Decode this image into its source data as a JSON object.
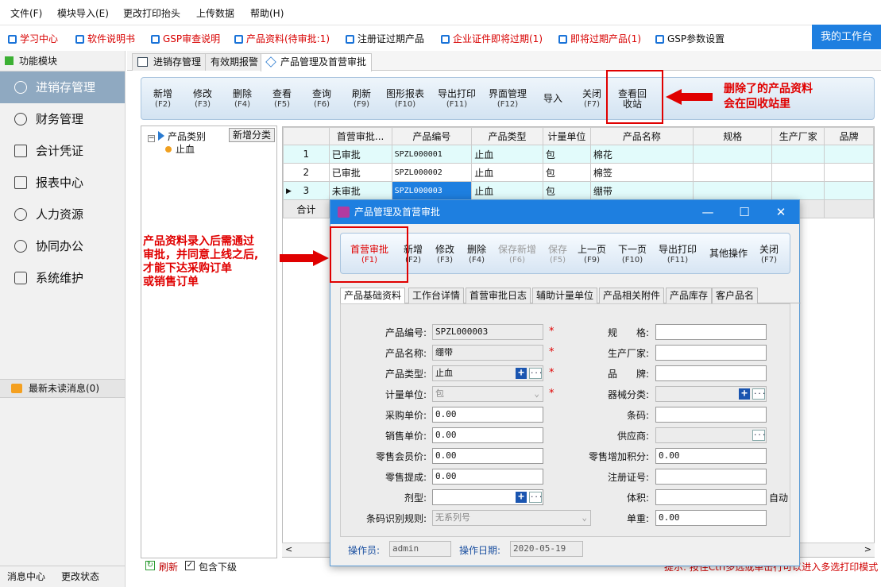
{
  "menubar": {
    "file": "文件(F)",
    "import": "模块导入(E)",
    "print_header": "更改打印抬头",
    "upload": "上传数据",
    "help": "帮助(H)"
  },
  "quickbar": {
    "items": [
      "学习中心",
      "软件说明书",
      "GSP审查说明",
      "产品资料(待审批:1)",
      "注册证过期产品",
      "企业证件即将过期(1)",
      "即将过期产品(1)",
      "GSP参数设置"
    ],
    "workbench": "我的工作台"
  },
  "leftnav": {
    "header": "功能模块",
    "items": [
      "进销存管理",
      "财务管理",
      "会计凭证",
      "报表中心",
      "人力资源",
      "协同办公",
      "系统维护"
    ],
    "messages": "最新未读消息(0)",
    "footer": [
      "消息中心",
      "更改状态"
    ]
  },
  "tabs": [
    "进销存管理",
    "有效期报警",
    "产品管理及首营审批"
  ],
  "toolbar": [
    {
      "label": "新增",
      "key": "(F2)"
    },
    {
      "label": "修改",
      "key": "(F3)"
    },
    {
      "label": "删除",
      "key": "(F4)"
    },
    {
      "label": "查看",
      "key": "(F5)"
    },
    {
      "label": "查询",
      "key": "(F6)"
    },
    {
      "label": "刷新",
      "key": "(F9)"
    },
    {
      "label": "图形报表",
      "key": "(F10)"
    },
    {
      "label": "导出打印",
      "key": "(F11)"
    },
    {
      "label": "界面管理",
      "key": "(F12)"
    },
    {
      "label": "导入",
      "key": ""
    },
    {
      "label": "关闭",
      "key": "(F7)"
    },
    {
      "label": "查看回",
      "key": "收站"
    }
  ],
  "tree": {
    "root": "产品类别",
    "add_button": "新增分类",
    "child": "止血"
  },
  "grid": {
    "columns": [
      "首营审批...",
      "产品编号",
      "产品类型",
      "计量单位",
      "产品名称",
      "规格",
      "生产厂家",
      "品牌"
    ],
    "rows": [
      [
        "1",
        "已审批",
        "SPZL000001",
        "止血",
        "包",
        "棉花",
        "",
        "",
        ""
      ],
      [
        "2",
        "已审批",
        "SPZL000002",
        "止血",
        "包",
        "棉签",
        "",
        "",
        ""
      ],
      [
        "3",
        "未审批",
        "SPZL000003",
        "止血",
        "包",
        "绷带",
        "",
        "",
        ""
      ]
    ],
    "total_label": "合计"
  },
  "bottombar": {
    "refresh": "刷新",
    "include_sub": "包含下级",
    "hint": "提示: 按住Ctrl多选或单击行可以进入多选打印模式"
  },
  "annotations": {
    "recycle": [
      "删除了的产品资料",
      "会在回收站里"
    ],
    "approval": [
      "产品资料录入后需通过",
      "审批，并同意上线之后,",
      "才能下达采购订单",
      "或销售订单"
    ]
  },
  "dialog": {
    "title": "产品管理及首营审批",
    "toolbar": [
      {
        "label": "首营审批",
        "key": "(F1)",
        "enabled": true
      },
      {
        "label": "新增",
        "key": "(F2)",
        "enabled": true
      },
      {
        "label": "修改",
        "key": "(F3)",
        "enabled": true
      },
      {
        "label": "删除",
        "key": "(F4)",
        "enabled": true
      },
      {
        "label": "保存新增",
        "key": "(F6)",
        "enabled": false
      },
      {
        "label": "保存",
        "key": "(F5)",
        "enabled": false
      },
      {
        "label": "上一页",
        "key": "(F9)",
        "enabled": true
      },
      {
        "label": "下一页",
        "key": "(F10)",
        "enabled": true
      },
      {
        "label": "导出打印",
        "key": "(F11)",
        "enabled": true
      },
      {
        "label": "其他操作",
        "key": "",
        "enabled": true
      },
      {
        "label": "关闭",
        "key": "(F7)",
        "enabled": true
      }
    ],
    "tabs": [
      "产品基础资料",
      "工作台详情",
      "首营审批日志",
      "辅助计量单位",
      "产品相关附件",
      "产品库存",
      "客户品名"
    ],
    "form": {
      "left": [
        {
          "label": "产品编号:",
          "value": "SPZL000003",
          "required": true
        },
        {
          "label": "产品名称:",
          "value": "绷带",
          "required": true
        },
        {
          "label": "产品类型:",
          "value": "止血",
          "required": true
        },
        {
          "label": "计量单位:",
          "value": "包",
          "required": true
        },
        {
          "label": "采购单价:",
          "value": "0.00",
          "required": false
        },
        {
          "label": "销售单价:",
          "value": "0.00",
          "required": false
        },
        {
          "label": "零售会员价:",
          "value": "0.00",
          "required": false
        },
        {
          "label": "零售提成:",
          "value": "0.00",
          "required": false
        },
        {
          "label": "剂型:",
          "value": "",
          "required": false
        },
        {
          "label": "条码识别规则:",
          "value": "无系列号",
          "required": false
        }
      ],
      "right": [
        {
          "label": "规　　格:",
          "value": ""
        },
        {
          "label": "生产厂家:",
          "value": ""
        },
        {
          "label": "品　　牌:",
          "value": ""
        },
        {
          "label": "器械分类:",
          "value": ""
        },
        {
          "label": "条码:",
          "value": ""
        },
        {
          "label": "供应商:",
          "value": ""
        },
        {
          "label": "零售增加积分:",
          "value": "0.00"
        },
        {
          "label": "注册证号:",
          "value": ""
        },
        {
          "label": "体积:",
          "value": ""
        },
        {
          "label": "单重:",
          "value": "0.00"
        }
      ],
      "auto_label": "自动"
    },
    "footer": {
      "operator_label": "操作员:",
      "operator": "admin",
      "date_label": "操作日期:",
      "date": "2020-05-19"
    }
  },
  "colors": {
    "accent": "#1e7fe0",
    "annotation": "#e00000",
    "nav_active": "#8fa9c1"
  }
}
